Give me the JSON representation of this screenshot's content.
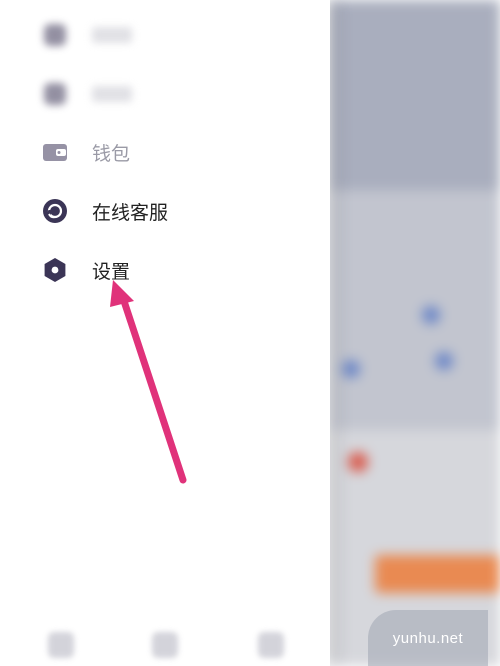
{
  "drawer": {
    "items": [
      {
        "label": "钱包",
        "icon": "wallet-icon"
      },
      {
        "label": "在线客服",
        "icon": "customer-service-icon"
      },
      {
        "label": "设置",
        "icon": "settings-icon"
      }
    ]
  },
  "colors": {
    "icon_dark": "#3b3556",
    "arrow": "#e0327a",
    "text": "#222222"
  },
  "watermark": {
    "text": "yunhu.net"
  }
}
